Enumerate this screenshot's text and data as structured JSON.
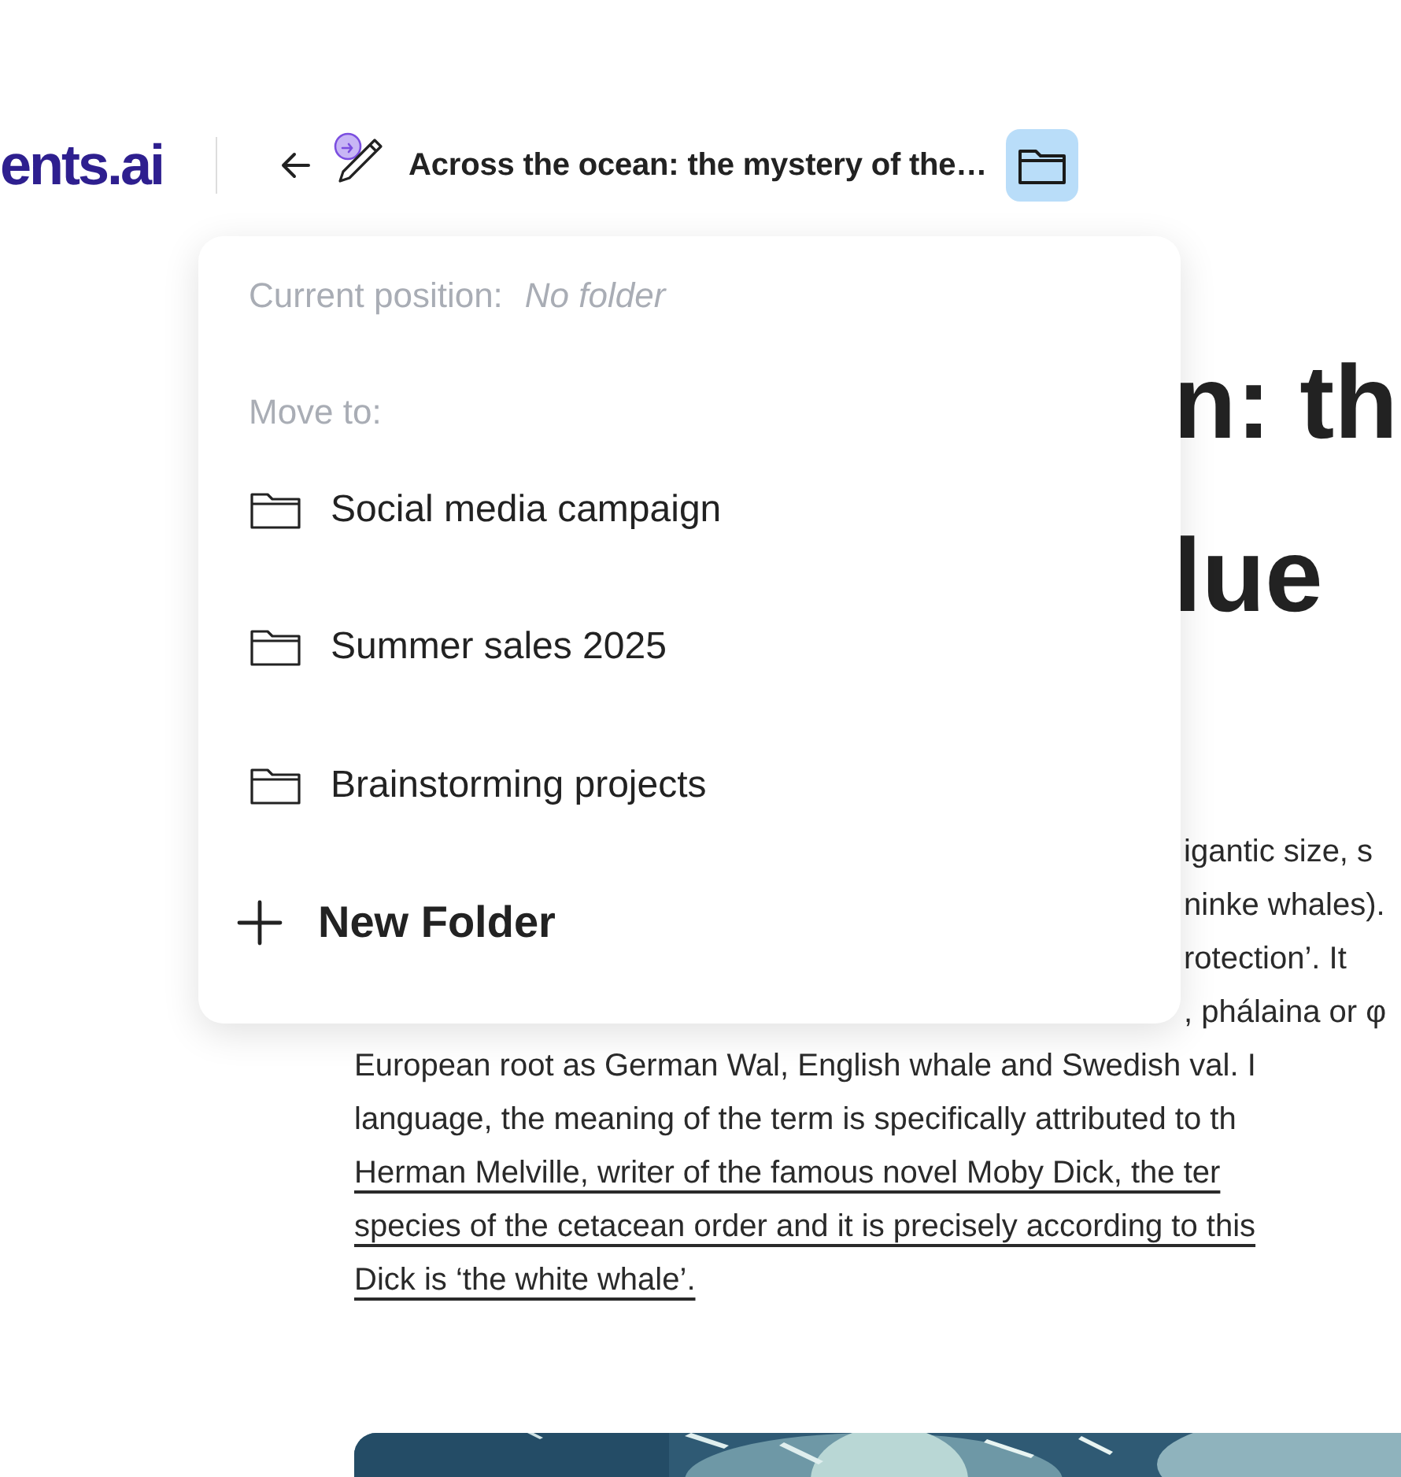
{
  "header": {
    "logo": "ents.ai",
    "title": "Across the ocean: the mystery of the…",
    "folder_button": {
      "active": true
    }
  },
  "article": {
    "heading_fragments": [
      "n: th",
      "lue"
    ],
    "lines": [
      {
        "kind": "fragment",
        "text": "igantic size, s",
        "underlined": false
      },
      {
        "kind": "fragment",
        "text": "ninke whales).",
        "underlined": false
      },
      {
        "kind": "fragment",
        "text": "rotection’. It",
        "underlined": false
      },
      {
        "kind": "fragment",
        "text": ", phálaina or φ",
        "underlined": false
      },
      {
        "kind": "line",
        "text": "European root as German Wal, English whale and Swedish val. I",
        "underlined": false
      },
      {
        "kind": "line",
        "text": "language, the meaning of the term is specifically attributed to th",
        "underlined": false
      },
      {
        "kind": "line",
        "text": "Herman Melville, writer of the famous novel Moby Dick, the ter",
        "underlined": true
      },
      {
        "kind": "line",
        "text": "species of the cetacean order and it is precisely according to this",
        "underlined": true
      },
      {
        "kind": "line",
        "text": "Dick is ‘the white whale’.",
        "underlined": true
      }
    ],
    "image": {
      "kind": "picture"
    }
  },
  "popup": {
    "current_label": "Current position:",
    "current_value": "No folder",
    "move_label": "Move to:",
    "folders": [
      "Social media campaign",
      "Summer sales 2025",
      "Brainstorming projects"
    ],
    "new_folder": "New Folder"
  }
}
